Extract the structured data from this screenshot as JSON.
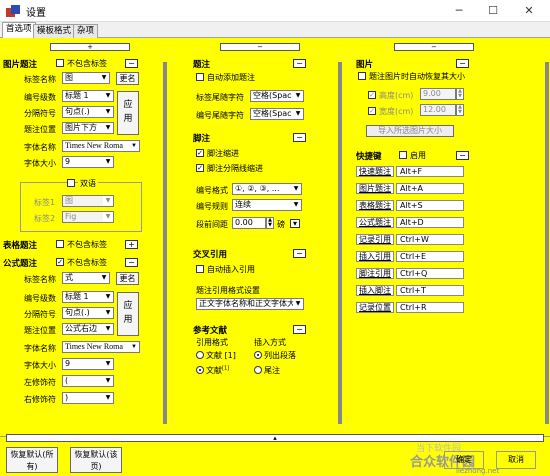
{
  "window": {
    "title": "设置"
  },
  "tabs": [
    "首选项",
    "模板格式",
    "杂项"
  ],
  "left": {
    "figure": {
      "title": "图片题注",
      "no_label": "不包含标签",
      "label_name_lbl": "标签名称",
      "label_name": "图",
      "more": "更名",
      "number_lbl": "编号级数",
      "number": "标题 1",
      "separator_lbl": "分隔符号",
      "separator": "句点(.)",
      "apply": "应用",
      "position_lbl": "题注位置",
      "position": "图片下方",
      "font_lbl": "字体名称",
      "font": "Times New Roma",
      "size_lbl": "字体大小",
      "size": "9"
    },
    "bilingual": {
      "title": "双语",
      "tag1_lbl": "标签1",
      "tag1": "图",
      "tag2_lbl": "标签2",
      "tag2": "Fig"
    },
    "table": {
      "title": "表格题注",
      "no_label": "不包含标签"
    },
    "formula": {
      "title": "公式题注",
      "no_label": "不包含标签",
      "label_name_lbl": "标签名称",
      "label_name": "式",
      "more": "更名",
      "number_lbl": "编号级数",
      "number": "标题 1",
      "separator_lbl": "分隔符号",
      "separator": "句点(.)",
      "apply": "应用",
      "position_lbl": "题注位置",
      "position": "公式右边",
      "font_lbl": "字体名称",
      "font": "Times New Roma",
      "size_lbl": "字体大小",
      "size": "9",
      "left_lbl": "左修饰符",
      "left": "(",
      "right_lbl": "右修饰符",
      "right": ")"
    }
  },
  "mid": {
    "caption": {
      "title": "题注",
      "auto": "自动添加题注",
      "follow_lbl": "标签尾随字符",
      "follow": "空格(Spac",
      "numfollow_lbl": "编号尾随字符",
      "numfollow": "空格(Spac"
    },
    "footnote": {
      "title": "脚注",
      "indent": "脚注缩进",
      "hang": "脚注分隔线缩进",
      "format_lbl": "编号格式",
      "format": "①, ②, ③, ...",
      "rule_lbl": "编号规则",
      "rule": "连续",
      "spacing_lbl": "段前间距",
      "spacing": "0.00",
      "unit": "磅"
    },
    "xref": {
      "title": "交叉引用",
      "auto": "自动插入引用",
      "setting_lbl": "题注引用格式设置",
      "setting": "正文字体名称和正文字体大"
    },
    "refs": {
      "title": "参考文献",
      "style_lbl": "引用格式",
      "insert_lbl": "插入方式",
      "opt1": "文献 [1]",
      "opt2": "文献",
      "opt2_sup": "[1]",
      "ins1": "列出段落",
      "ins2": "尾注"
    }
  },
  "right": {
    "image": {
      "title": "图片",
      "autosize": "题注图片时自动恢复其大小",
      "h_lbl": "高度(cm)",
      "h": "9.00",
      "w_lbl": "宽度(cm)",
      "w": "12.00",
      "import": "导入所选图片大小"
    },
    "hotkeys": {
      "title": "快捷键",
      "enable": "启用",
      "rows": [
        [
          "快速题注",
          "Alt+F"
        ],
        [
          "图片题注",
          "Alt+A"
        ],
        [
          "表格题注",
          "Alt+S"
        ],
        [
          "公式题注",
          "Alt+D"
        ],
        [
          "记录引用",
          "Ctrl+W"
        ],
        [
          "插入引用",
          "Ctrl+E"
        ],
        [
          "脚注引用",
          "Ctrl+Q"
        ],
        [
          "插入脚注",
          "Ctrl+T"
        ],
        [
          "记录位置",
          "Ctrl+R"
        ]
      ]
    }
  },
  "bottom": {
    "restore_all": "恢复默认(所有)",
    "restore_page": "恢复默认(该页)",
    "ok": "确定",
    "cancel": "取消",
    "watermark": "当下软件园",
    "watermark2": "合众软件园",
    "watermark_url": "liezhong.net"
  }
}
